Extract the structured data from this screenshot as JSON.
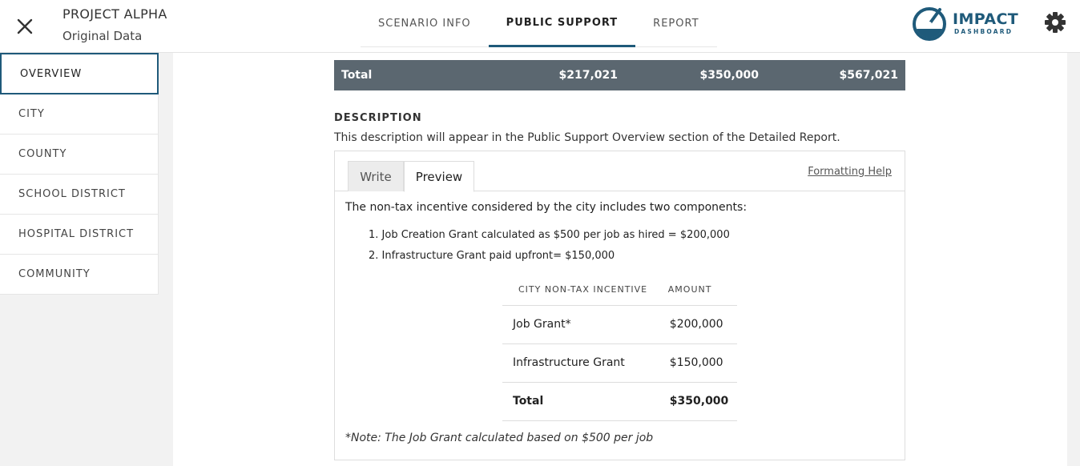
{
  "header": {
    "project_title": "PROJECT ALPHA",
    "project_subtitle": "Original Data",
    "tabs": [
      {
        "label": "SCENARIO INFO"
      },
      {
        "label": "PUBLIC SUPPORT"
      },
      {
        "label": "REPORT"
      }
    ],
    "active_tab": "PUBLIC SUPPORT",
    "logo": {
      "word": "IMPACT",
      "sub": "DASHBOARD"
    },
    "accent_color": "#1f5a7a"
  },
  "sidebar": {
    "items": [
      {
        "label": "OVERVIEW"
      },
      {
        "label": "CITY"
      },
      {
        "label": "COUNTY"
      },
      {
        "label": "SCHOOL DISTRICT"
      },
      {
        "label": "HOSPITAL DISTRICT"
      },
      {
        "label": "COMMUNITY"
      }
    ],
    "active": "OVERVIEW"
  },
  "totals": {
    "label": "Total",
    "values": [
      "$217,021",
      "$350,000",
      "$567,021"
    ]
  },
  "description": {
    "heading": "DESCRIPTION",
    "help": "This description will appear in the Public Support Overview section of the Detailed Report.",
    "tabs": {
      "write": "Write",
      "preview": "Preview"
    },
    "active_tab": "Preview",
    "formatting_help": "Formatting Help",
    "preview": {
      "intro": "The non-tax incentive considered by the city includes two components:",
      "list": [
        "1.  Job Creation Grant calculated as $500 per job as hired = $200,000",
        "2.  Infrastructure Grant paid upfront= $150,000"
      ],
      "table": {
        "headers": [
          "CITY NON-TAX INCENTIVE",
          "AMOUNT"
        ],
        "rows": [
          [
            "Job Grant*",
            "$200,000"
          ],
          [
            "Infrastructure Grant",
            "$150,000"
          ]
        ],
        "total": [
          "Total",
          "$350,000"
        ]
      },
      "note": "*Note: The Job Grant calculated based on $500 per job"
    }
  }
}
